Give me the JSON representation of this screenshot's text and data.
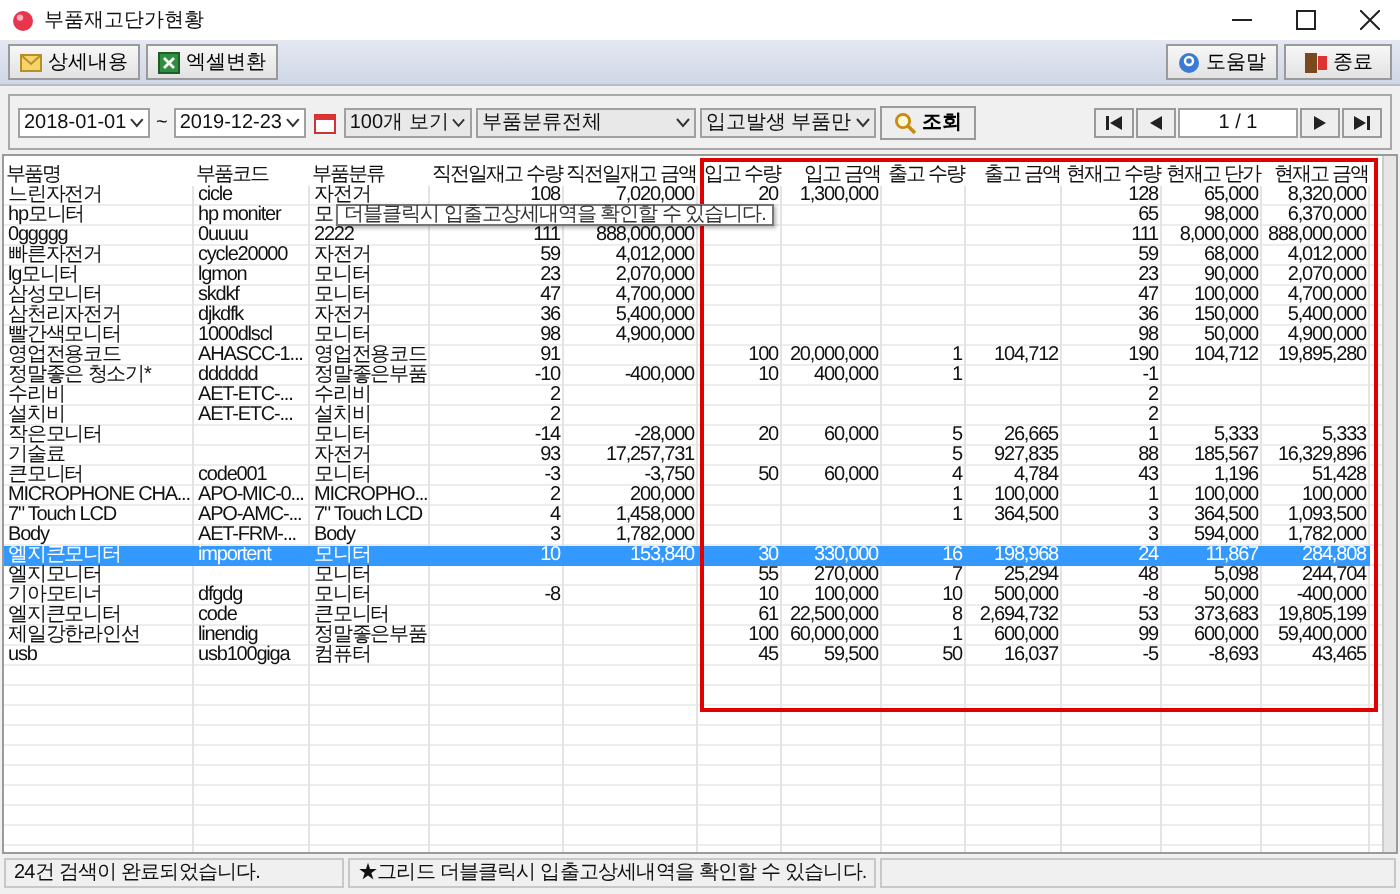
{
  "window": {
    "title": "부품재고단가현황"
  },
  "toolbar": {
    "left": [
      {
        "kind": "detail",
        "label": "상세내용"
      },
      {
        "kind": "excel",
        "label": "엑셀변환"
      }
    ],
    "right": [
      {
        "kind": "help",
        "label": "도움말"
      },
      {
        "kind": "exit",
        "label": "종료"
      }
    ]
  },
  "filter": {
    "date_from": "2018-01-01",
    "separator": "~",
    "date_to": "2019-12-23",
    "dropdowns": [
      "100개 보기",
      "부품분류전체",
      "입고발생 부품만"
    ],
    "search_button": "조회",
    "page": "1 / 1"
  },
  "table": {
    "columns": [
      "부품명",
      "부품코드",
      "부품분류",
      "직전일재고 수량",
      "직전일재고 금액",
      "입고 수량",
      "입고 금액",
      "출고 수량",
      "출고 금액",
      "현재고 수량",
      "현재고 단가",
      "현재고 금액"
    ],
    "rows": [
      {
        "selected": false,
        "cells": [
          "느린자전거",
          "cicle",
          "자전거",
          "108",
          "7,020,000",
          "20",
          "1,300,000",
          null,
          null,
          "128",
          "65,000",
          "8,320,000"
        ]
      },
      {
        "selected": false,
        "cells": [
          "hp모니터",
          "hp moniter",
          "모",
          null,
          null,
          null,
          null,
          null,
          null,
          "65",
          "98,000",
          "6,370,000"
        ]
      },
      {
        "selected": false,
        "cells": [
          "0ggggg",
          "0uuuu",
          "2222",
          "111",
          "888,000,000",
          null,
          null,
          null,
          null,
          "111",
          "8,000,000",
          "888,000,000"
        ]
      },
      {
        "selected": false,
        "cells": [
          "빠른자전거",
          "cycle20000",
          "자전거",
          "59",
          "4,012,000",
          null,
          null,
          null,
          null,
          "59",
          "68,000",
          "4,012,000"
        ]
      },
      {
        "selected": false,
        "cells": [
          "lg모니터",
          "lgmon",
          "모니터",
          "23",
          "2,070,000",
          null,
          null,
          null,
          null,
          "23",
          "90,000",
          "2,070,000"
        ]
      },
      {
        "selected": false,
        "cells": [
          "삼성모니터",
          "skdkf",
          "모니터",
          "47",
          "4,700,000",
          null,
          null,
          null,
          null,
          "47",
          "100,000",
          "4,700,000"
        ]
      },
      {
        "selected": false,
        "cells": [
          "삼천리자전거",
          "djkdfk",
          "자전거",
          "36",
          "5,400,000",
          null,
          null,
          null,
          null,
          "36",
          "150,000",
          "5,400,000"
        ]
      },
      {
        "selected": false,
        "cells": [
          "빨간색모니터",
          "1000dlscl",
          "모니터",
          "98",
          "4,900,000",
          null,
          null,
          null,
          null,
          "98",
          "50,000",
          "4,900,000"
        ]
      },
      {
        "selected": false,
        "cells": [
          "영업전용코드",
          "AHASCC-1...",
          "영업전용코드",
          "91",
          null,
          "100",
          "20,000,000",
          "1",
          "104,712",
          "190",
          "104,712",
          "19,895,280"
        ]
      },
      {
        "selected": false,
        "cells": [
          "정말좋은 청소기*",
          "dddddd",
          "정말좋은부품",
          "-10",
          "-400,000",
          "10",
          "400,000",
          "1",
          null,
          "-1",
          null,
          null
        ]
      },
      {
        "selected": false,
        "cells": [
          "수리비",
          "AET-ETC-...",
          "수리비",
          "2",
          null,
          null,
          null,
          null,
          null,
          "2",
          null,
          null
        ]
      },
      {
        "selected": false,
        "cells": [
          "설치비",
          "AET-ETC-...",
          "설치비",
          "2",
          null,
          null,
          null,
          null,
          null,
          "2",
          null,
          null
        ]
      },
      {
        "selected": false,
        "cells": [
          "작은모니터",
          null,
          "모니터",
          "-14",
          "-28,000",
          "20",
          "60,000",
          "5",
          "26,665",
          "1",
          "5,333",
          "5,333"
        ]
      },
      {
        "selected": false,
        "cells": [
          "기술료",
          null,
          "자전거",
          "93",
          "17,257,731",
          null,
          null,
          "5",
          "927,835",
          "88",
          "185,567",
          "16,329,896"
        ]
      },
      {
        "selected": false,
        "cells": [
          "큰모니터",
          "code001",
          "모니터",
          "-3",
          "-3,750",
          "50",
          "60,000",
          "4",
          "4,784",
          "43",
          "1,196",
          "51,428"
        ]
      },
      {
        "selected": false,
        "cells": [
          "MICROPHONE CHA...",
          "APO-MIC-0...",
          "MICROPHO...",
          "2",
          "200,000",
          null,
          null,
          "1",
          "100,000",
          "1",
          "100,000",
          "100,000"
        ]
      },
      {
        "selected": false,
        "cells": [
          "7\" Touch LCD",
          "APO-AMC-...",
          "7\" Touch LCD",
          "4",
          "1,458,000",
          null,
          null,
          "1",
          "364,500",
          "3",
          "364,500",
          "1,093,500"
        ]
      },
      {
        "selected": false,
        "cells": [
          "Body",
          "AET-FRM-...",
          "Body",
          "3",
          "1,782,000",
          null,
          null,
          null,
          null,
          "3",
          "594,000",
          "1,782,000"
        ]
      },
      {
        "selected": true,
        "cells": [
          "엘지큰모니터",
          "importent",
          "모니터",
          "10",
          "153,840",
          "30",
          "330,000",
          "16",
          "198,968",
          "24",
          "11,867",
          "284,808"
        ]
      },
      {
        "selected": false,
        "cells": [
          "엘지모니터",
          null,
          "모니터",
          null,
          null,
          "55",
          "270,000",
          "7",
          "25,294",
          "48",
          "5,098",
          "244,704"
        ]
      },
      {
        "selected": false,
        "cells": [
          "기아모티너",
          "dfgdg",
          "모니터",
          "-8",
          null,
          "10",
          "100,000",
          "10",
          "500,000",
          "-8",
          "50,000",
          "-400,000"
        ]
      },
      {
        "selected": false,
        "cells": [
          "엘지큰모니터",
          "code",
          "큰모니터",
          null,
          null,
          "61",
          "22,500,000",
          "8",
          "2,694,732",
          "53",
          "373,683",
          "19,805,199"
        ]
      },
      {
        "selected": false,
        "cells": [
          "제일강한라인선",
          "linendig",
          "정말좋은부품",
          null,
          null,
          "100",
          "60,000,000",
          "1",
          "600,000",
          "99",
          "600,000",
          "59,400,000"
        ]
      },
      {
        "selected": false,
        "cells": [
          "usb",
          "usb100giga",
          "컴퓨터",
          null,
          null,
          "45",
          "59,500",
          "50",
          "16,037",
          "-5",
          "-8,693",
          "43,465"
        ]
      }
    ]
  },
  "tooltip": "더블클릭시 입출고상세내역을 확인할 수 있습니다.",
  "status_bar": [
    "24건 검색이 완료되었습니다.",
    "★그리드 더블클릭시 입출고상세내역을 확인할 수 있습니다."
  ]
}
